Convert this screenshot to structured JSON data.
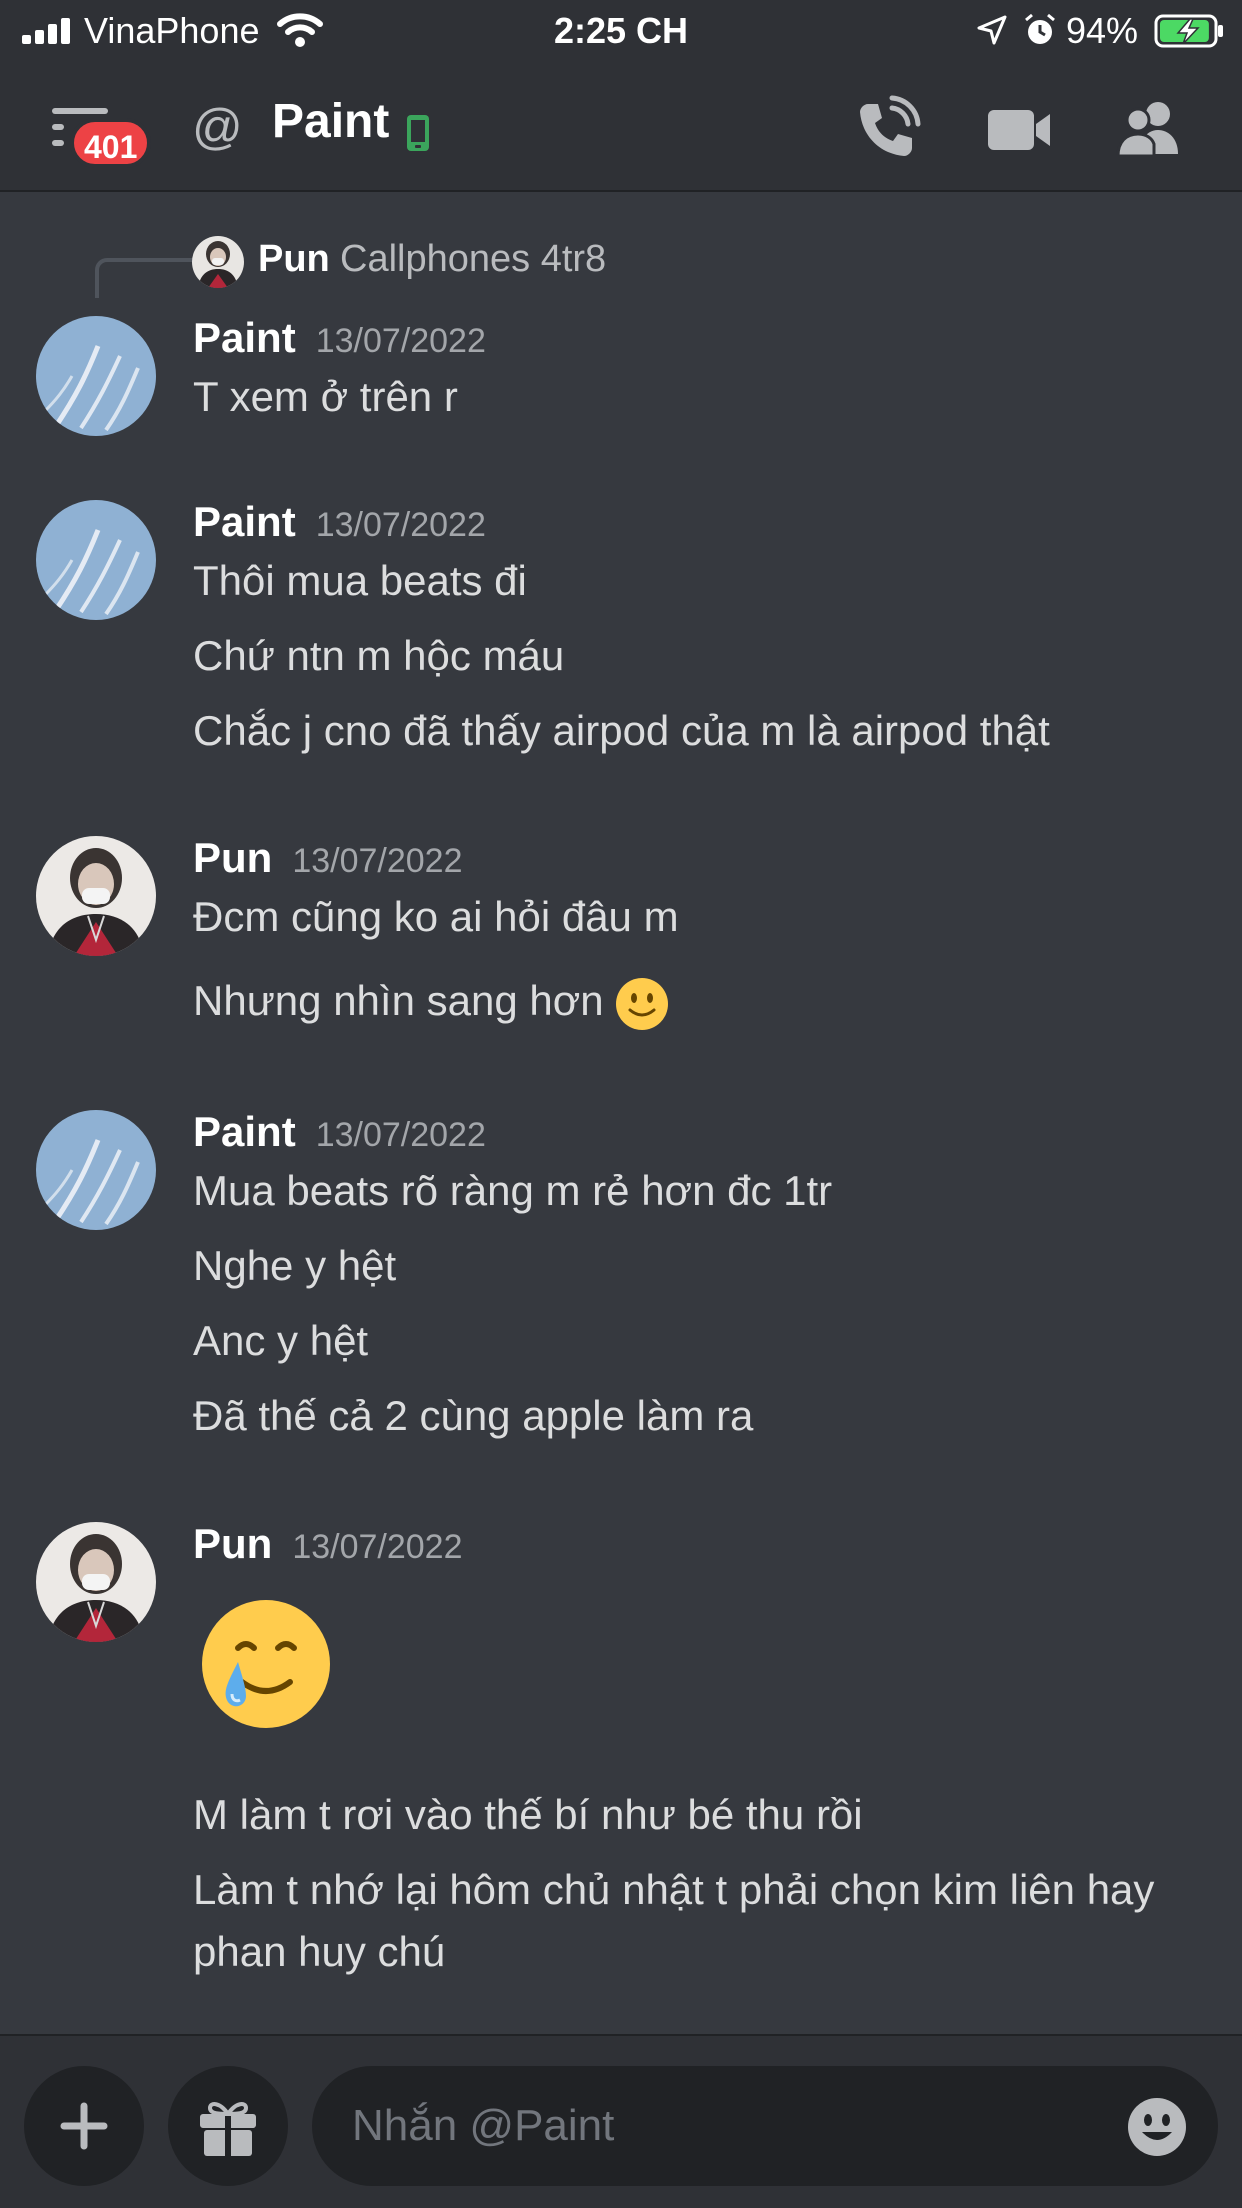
{
  "status_bar": {
    "carrier": "VinaPhone",
    "time": "2:25 CH",
    "battery_percent": "94%",
    "battery_level": 0.94,
    "icons": [
      "signal-icon",
      "wifi-icon",
      "location-icon",
      "alarm-icon",
      "battery-icon"
    ]
  },
  "header": {
    "unread_badge": "401",
    "at_symbol": "@",
    "channel_name": "Paint",
    "icons": [
      "hamburger-icon",
      "mobile-status-icon",
      "voice-call-icon",
      "video-call-icon",
      "members-icon"
    ]
  },
  "reply_preview": {
    "author": "Pun",
    "text": "Callphones 4tr8"
  },
  "groups": [
    {
      "author": "Paint",
      "timestamp": "13/07/2022",
      "messages": [
        "T xem ở trên r"
      ]
    },
    {
      "author": "Paint",
      "timestamp": "13/07/2022",
      "messages": [
        "Thôi mua beats đi",
        "Chứ ntn m hộc máu",
        "Chắc j cno đã thấy airpod của m là airpod thật"
      ]
    },
    {
      "author": "Pun",
      "timestamp": "13/07/2022",
      "messages": [
        "Đcm cũng ko ai hỏi đâu m",
        "Nhưng nhìn sang hơn"
      ],
      "inline_emoji": "slightly-smiling-face"
    },
    {
      "author": "Paint",
      "timestamp": "13/07/2022",
      "messages": [
        "Mua beats rõ ràng m rẻ hơn đc 1tr",
        "Nghe y hệt",
        "Anc y hệt",
        "Đã thế cả 2 cùng apple làm ra"
      ]
    },
    {
      "author": "Pun",
      "timestamp": "13/07/2022",
      "big_emoji": "smiling-face-with-tear",
      "messages": [
        "M làm t rơi vào thế bí như bé thu rồi",
        "Làm t nhớ lại hôm chủ nhật t phải chọn kim liên hay phan huy chú"
      ]
    }
  ],
  "input_bar": {
    "placeholder": "Nhắn @Paint",
    "icons": [
      "plus-icon",
      "gift-icon",
      "emoji-icon"
    ]
  },
  "colors": {
    "background": "#36393f",
    "header_background": "#2f3136",
    "badge": "#ed4245",
    "online_mobile": "#3ba55c",
    "muted_text": "#a3a6aa"
  }
}
